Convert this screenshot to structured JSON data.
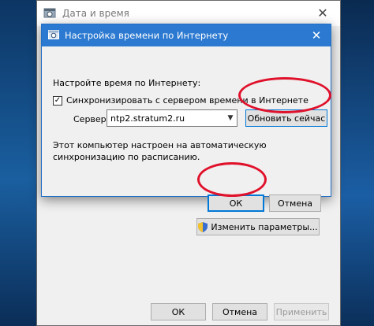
{
  "parent_window": {
    "title": "Дата и время",
    "change_settings_label": "Изменить параметры...",
    "footer": {
      "ok_label": "ОК",
      "cancel_label": "Отмена",
      "apply_label": "Применить"
    }
  },
  "dialog": {
    "title": "Настройка времени по Интернету",
    "setup_label": "Настройте время по Интернету:",
    "sync_checkbox_label": "Синхронизировать с сервером времени в Интернете",
    "sync_checked": true,
    "server_label": "Сервер:",
    "server_value": "ntp2.stratum2.ru",
    "update_now_label": "Обновить сейчас",
    "info_text": "Этот компьютер настроен на автоматическую синхронизацию по расписанию.",
    "ok_label": "ОК",
    "cancel_label": "Отмена"
  },
  "colors": {
    "dialog_titlebar": "#2b79d0",
    "highlight": "#e0112b",
    "focus_border": "#0078d7"
  }
}
